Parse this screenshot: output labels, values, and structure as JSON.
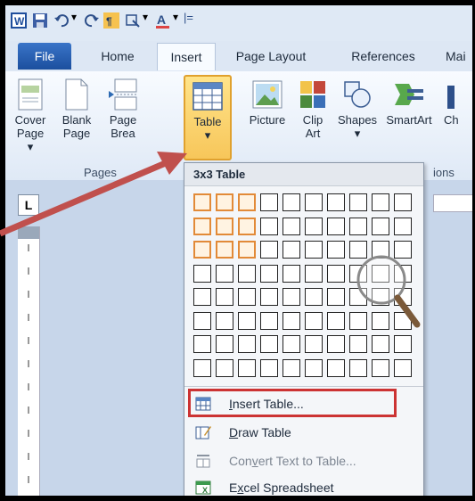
{
  "tabs": {
    "file": "File",
    "home": "Home",
    "insert": "Insert",
    "page_layout": "Page Layout",
    "references": "References",
    "mailings": "Mai"
  },
  "ribbon": {
    "cover_page": [
      "Cover",
      "Page ▾"
    ],
    "blank_page": [
      "Blank",
      "Page"
    ],
    "page_break": [
      "Page",
      "Brea"
    ],
    "table": [
      "Table",
      "▾"
    ],
    "picture": [
      "Picture",
      ""
    ],
    "clip_art": [
      "Clip",
      "Art"
    ],
    "shapes": [
      "Shapes",
      "▾"
    ],
    "smartart": [
      "SmartArt",
      ""
    ],
    "chart": [
      "Ch",
      ""
    ],
    "group_pages": "Pages",
    "group_illustrations": "ions"
  },
  "menu": {
    "title": "3x3 Table",
    "grid": {
      "rows": 8,
      "cols": 10,
      "selected_rows": 3,
      "selected_cols": 3
    },
    "items": [
      {
        "prefix": "",
        "accel": "I",
        "rest": "nsert Table...",
        "enabled": true,
        "icon": "insert-table-icon"
      },
      {
        "prefix": "",
        "accel": "D",
        "rest": "raw Table",
        "enabled": true,
        "icon": "draw-table-icon"
      },
      {
        "prefix": "Con",
        "accel": "v",
        "rest": "ert Text to Table...",
        "enabled": false,
        "icon": "convert-text-icon"
      },
      {
        "prefix": "E",
        "accel": "x",
        "rest": "cel Spreadsheet",
        "enabled": true,
        "icon": "excel-spreadsheet-icon"
      }
    ]
  },
  "colors": {
    "highlight_box": "#cc3333",
    "arrow": "#c0504d",
    "selected_cell": "#e28a38"
  }
}
